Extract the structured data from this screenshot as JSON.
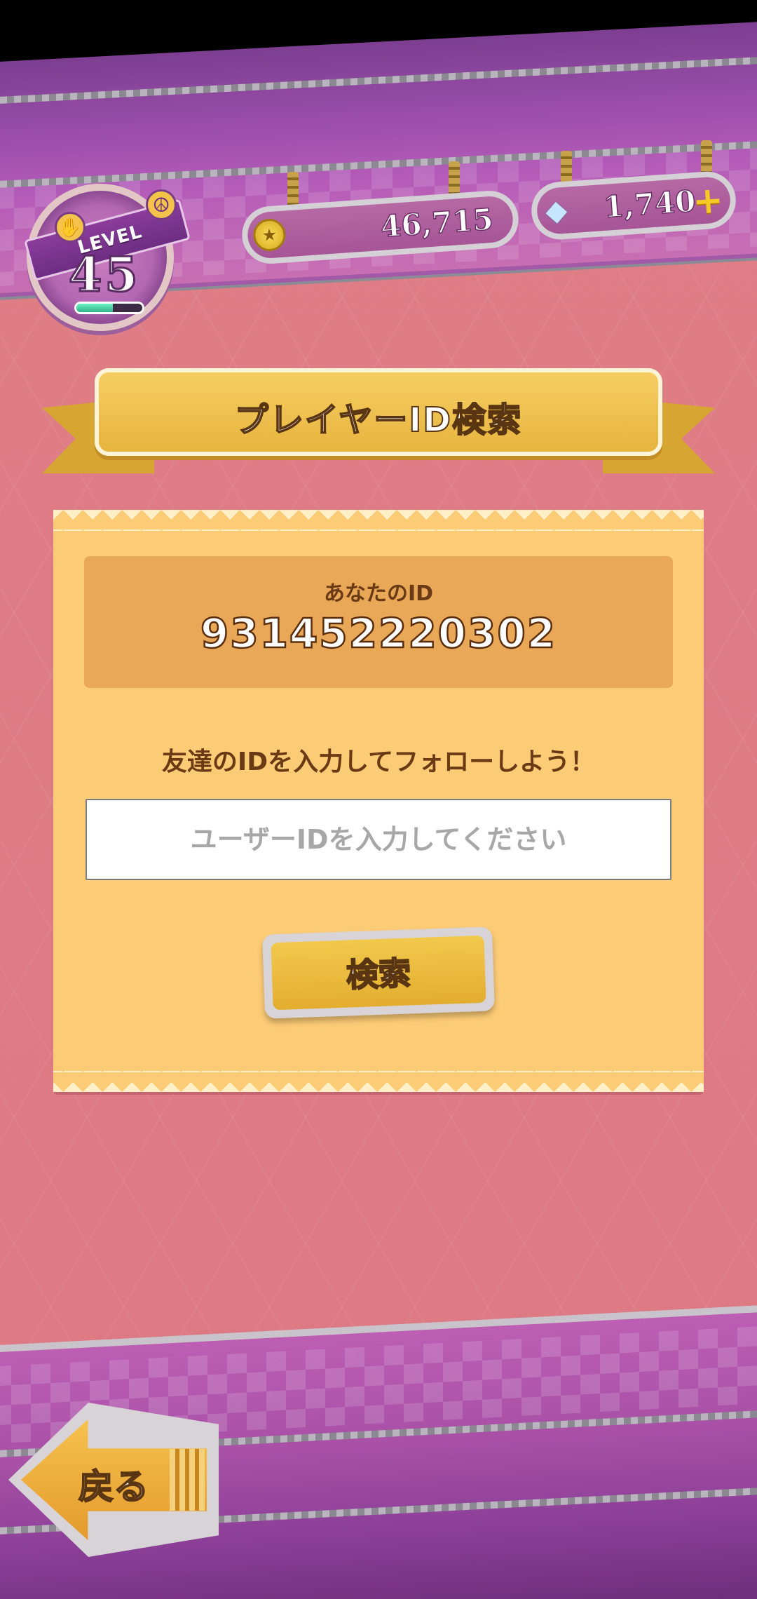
{
  "header": {
    "level_label": "LEVEL",
    "level_value": "45",
    "level_progress": 0.55,
    "coins": "46,715",
    "gems": "1,740"
  },
  "title": "プレイヤーID検索",
  "panel": {
    "your_id_label": "あなたのID",
    "your_id_value": "931452220302",
    "prompt": "友達のIDを入力してフォローしよう！",
    "input_placeholder": "ユーザーIDを入力してください",
    "search_button": "検索"
  },
  "footer": {
    "back_button": "戻る"
  }
}
